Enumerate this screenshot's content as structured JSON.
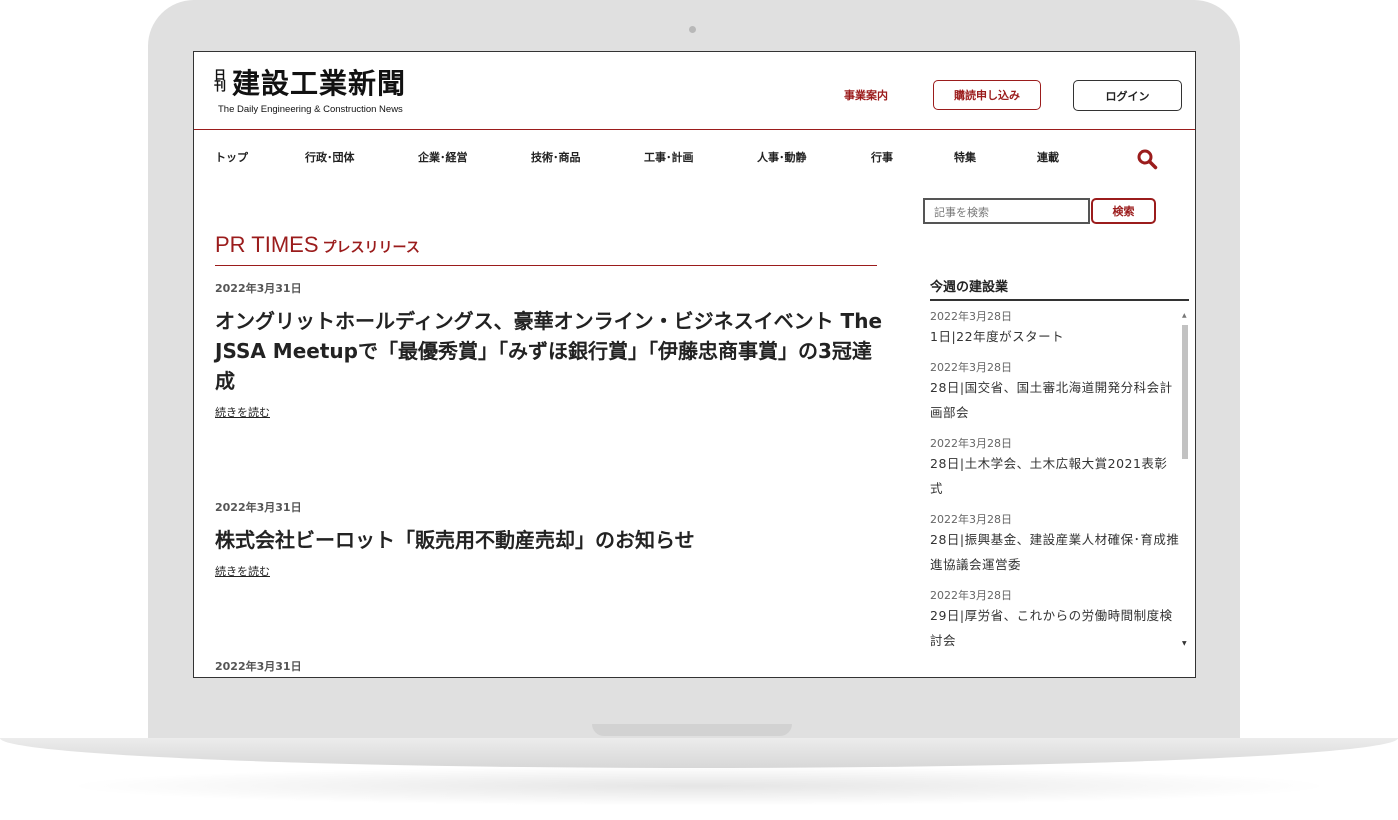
{
  "header": {
    "logo_small": "日刊",
    "logo_main": "建設工業新聞",
    "logo_sub": "The Daily Engineering & Construction News",
    "business_link": "事業案内",
    "subscribe_button": "購読申し込み",
    "login_button": "ログイン"
  },
  "nav": {
    "items": [
      "トップ",
      "行政･団体",
      "企業･経営",
      "技術･商品",
      "工事･計画",
      "人事･動静",
      "行事",
      "特集",
      "連載"
    ],
    "search_icon": "search-icon"
  },
  "search": {
    "placeholder": "記事を検索",
    "button": "検索"
  },
  "main": {
    "section_title": "PR TIMES",
    "section_subtitle": "プレスリリース",
    "articles": [
      {
        "date": "2022年3月31日",
        "title": "オングリットホールディングス、豪華オンライン・ビジネスイベント The JSSA Meetupで「最優秀賞」「みずほ銀行賞」「伊藤忠商事賞」の3冠達成",
        "more": "続きを読む"
      },
      {
        "date": "2022年3月31日",
        "title": "株式会社ビーロット「販売用不動産売却」のお知らせ",
        "more": "続きを読む"
      },
      {
        "date": "2022年3月31日"
      }
    ]
  },
  "sidebar": {
    "heading": "今週の建設業",
    "items": [
      {
        "date": "2022年3月28日",
        "text": "1日|22年度がスタート"
      },
      {
        "date": "2022年3月28日",
        "text": "28日|国交省、国土審北海道開発分科会計画部会"
      },
      {
        "date": "2022年3月28日",
        "text": "28日|土木学会、土木広報大賞2021表彰式"
      },
      {
        "date": "2022年3月28日",
        "text": "28日|振興基金、建設産業人材確保･育成推進協議会運営委"
      },
      {
        "date": "2022年3月28日",
        "text": "29日|厚労省、これからの労働時間制度検討会"
      }
    ]
  },
  "colors": {
    "accent": "#9b1c1c",
    "frame": "#e0e0e0"
  }
}
